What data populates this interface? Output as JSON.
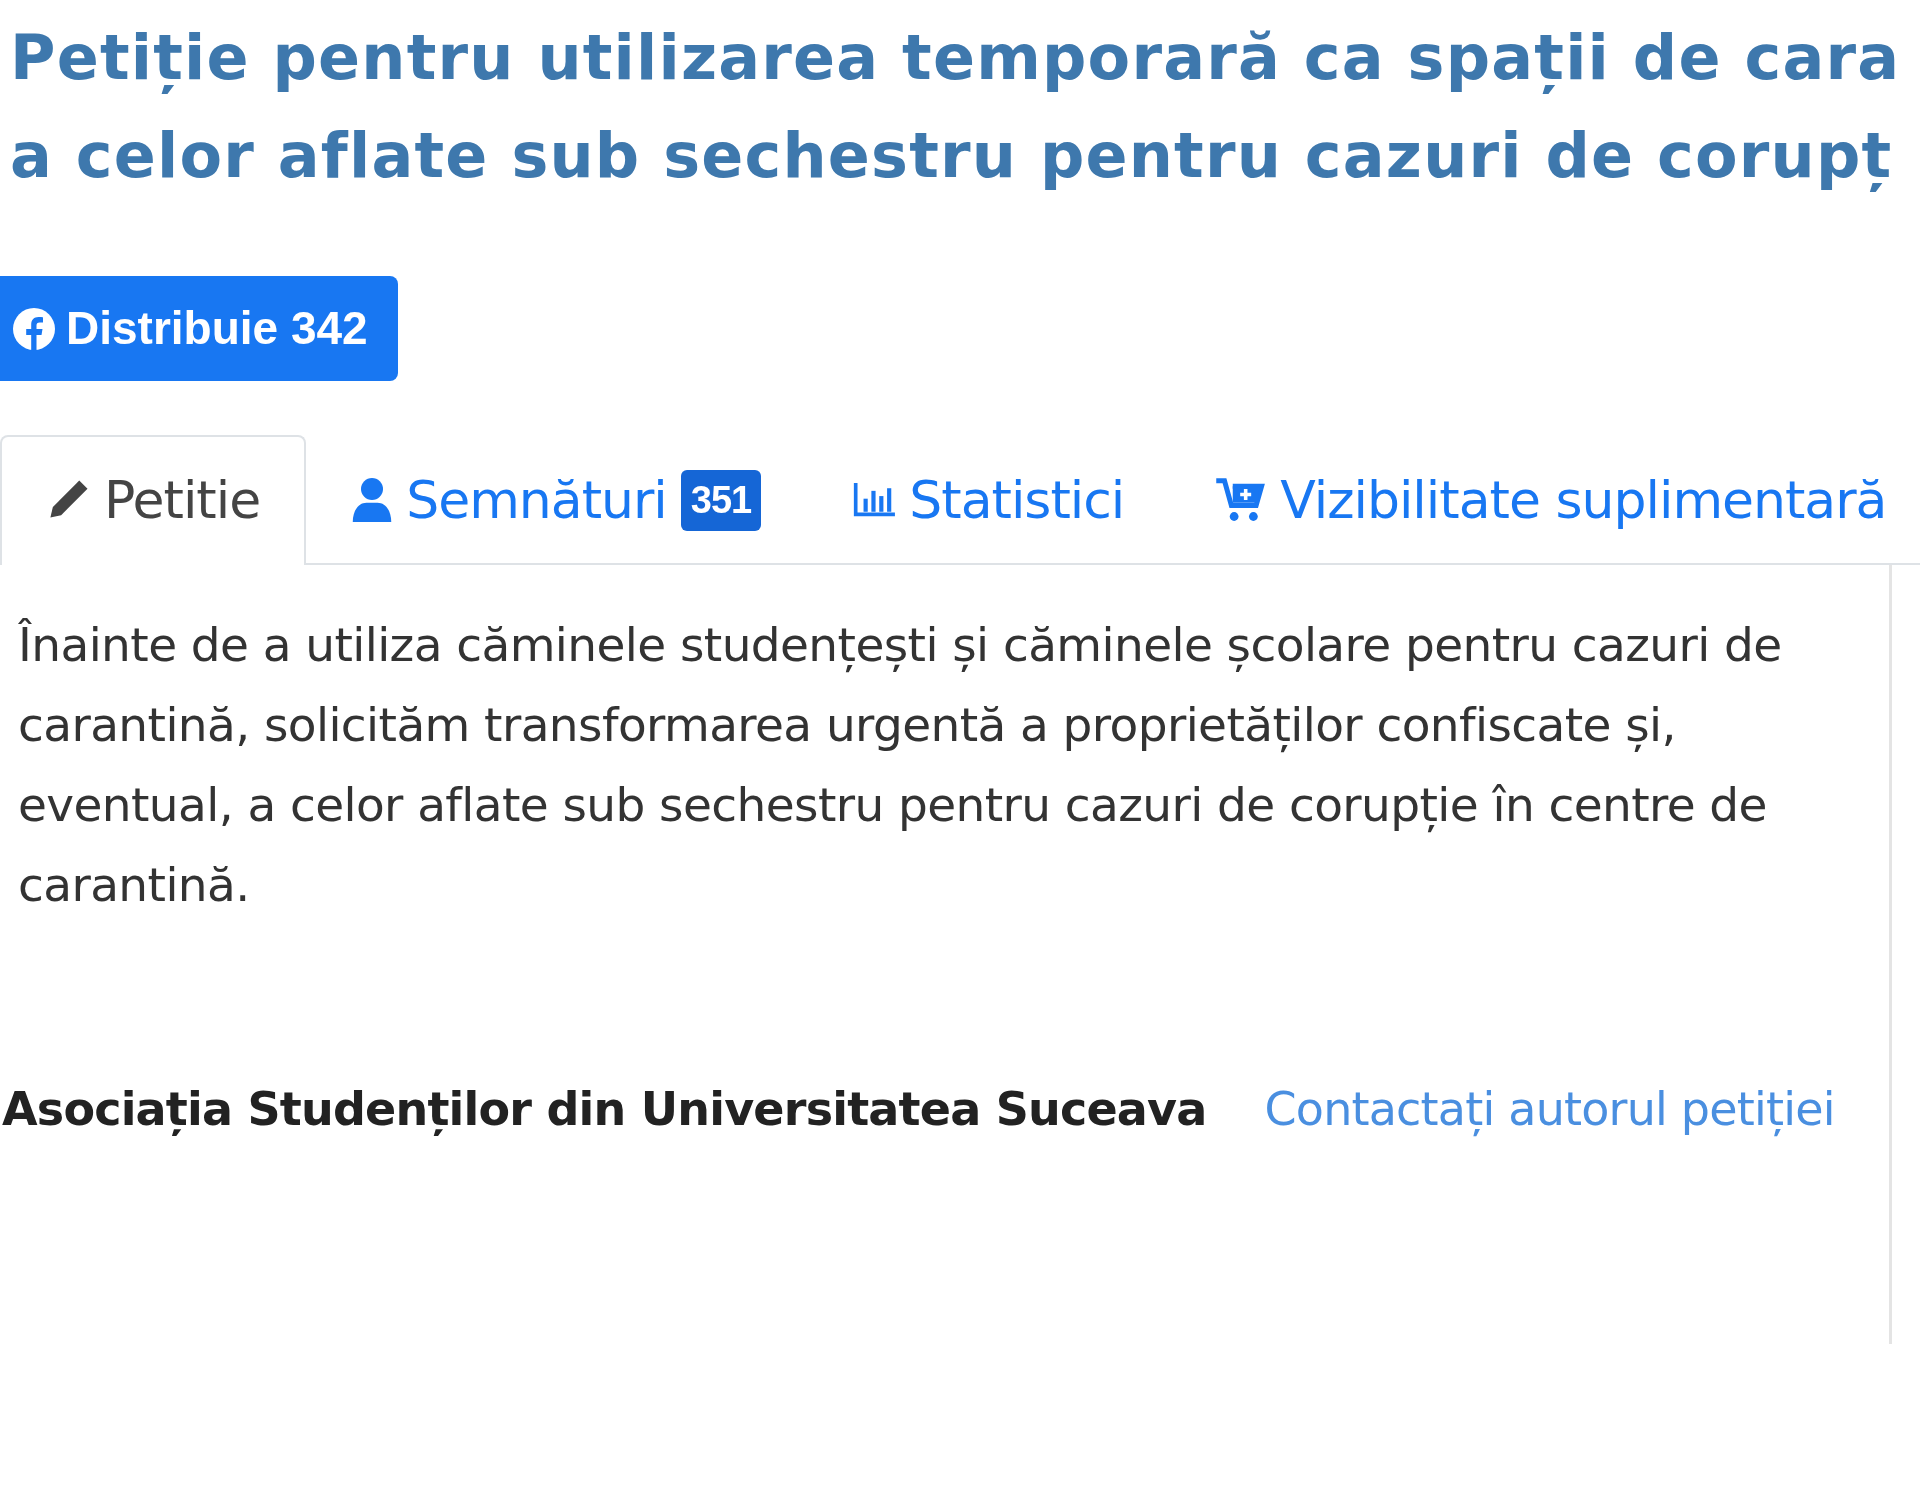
{
  "title_lines": [
    "Petiție pentru utilizarea temporară ca spații de cara",
    "a celor aflate sub sechestru pentru cazuri de corupț"
  ],
  "share_button": {
    "label": "Distribuie 342"
  },
  "tabs": [
    {
      "kind": "pencil",
      "label": "Petitie",
      "selected": true
    },
    {
      "kind": "person",
      "label": "Semnături",
      "badge": "351",
      "selected": false
    },
    {
      "kind": "chart",
      "label": "Statistici",
      "selected": false
    },
    {
      "kind": "cart",
      "label": "Vizibilitate suplimentară",
      "selected": false
    }
  ],
  "body_text": "Înainte de a utiliza căminele studențești și căminele școlare pentru cazuri de carantină, solicităm transformarea urgentă a proprietăților confiscate și, eventual, a celor aflate sub sechestru pentru cazuri de corupție în centre de carantină.",
  "author": "Asociația Studenților din Universitatea Suceava",
  "contact_link": "Contactați autorul petiției"
}
